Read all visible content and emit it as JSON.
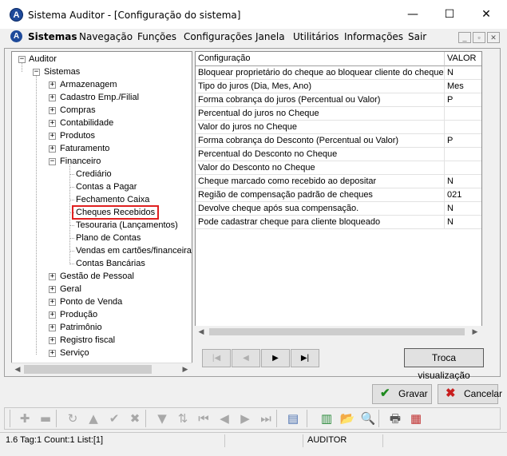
{
  "window": {
    "title": "Sistema Auditor - [Configuração do sistema]",
    "app_icon": "A",
    "minimize": "—",
    "maximize": "☐",
    "close": "✕"
  },
  "menu": {
    "icon": "A",
    "items": [
      "Sistemas",
      "Navegação",
      "Funções",
      "Configurações",
      "Janela",
      "Utilitários",
      "Informações",
      "Sair"
    ],
    "mdi_buttons": [
      "_",
      "▫",
      "✕"
    ]
  },
  "tree": {
    "root": "Auditor",
    "level1": "Sistemas",
    "items": [
      "Armazenagem",
      "Cadastro Emp./Filial",
      "Compras",
      "Contabilidade",
      "Produtos",
      "Faturamento",
      "Financeiro"
    ],
    "financeiro_children": [
      "Crediário",
      "Contas a Pagar",
      "Fechamento Caixa",
      "Cheques Recebidos",
      "Tesouraria (Lançamentos)",
      "Plano de Contas",
      "Vendas em cartões/financeiras",
      "Contas Bancárias"
    ],
    "items_after": [
      "Gestão de Pessoal",
      "Geral",
      "Ponto de Venda",
      "Produção",
      "Patrimônio",
      "Registro fiscal",
      "Serviço"
    ],
    "selected": "Cheques Recebidos"
  },
  "grid": {
    "columns": [
      "Configuração",
      "VALOR"
    ],
    "rows": [
      [
        "Bloquear proprietário do cheque ao bloquear cliente do cheque",
        "N"
      ],
      [
        "Tipo do juros (Dia, Mes, Ano)",
        "Mes"
      ],
      [
        "Forma cobrança do juros (Percentual ou Valor)",
        "P"
      ],
      [
        "Percentual do juros no Cheque",
        ""
      ],
      [
        "Valor do juros no Cheque",
        ""
      ],
      [
        "Forma cobrança do Desconto (Percentual ou Valor)",
        "P"
      ],
      [
        "Percentual do Desconto no Cheque",
        ""
      ],
      [
        "Valor do Desconto no Cheque",
        ""
      ],
      [
        "Cheque marcado como recebido ao depositar",
        "N"
      ],
      [
        "Região de compensação padrão de cheques",
        "021"
      ],
      [
        "Devolve cheque após sua compensação.",
        "N"
      ],
      [
        "Pode cadastrar cheque para cliente bloqueado",
        "N"
      ]
    ]
  },
  "nav": {
    "first": "|◀",
    "prev": "◀",
    "next": "▶",
    "last": "▶|",
    "toggle_view": "Troca visualização"
  },
  "actions": {
    "save_label": "Gravar",
    "save_icon": "✔",
    "cancel_label": "Cancelar",
    "cancel_icon": "✖"
  },
  "toolbar": {
    "icons": [
      "plus-icon",
      "minus-icon",
      "refresh-icon",
      "triangle-up-icon",
      "check-icon",
      "x-icon",
      "filter-icon",
      "sort-icon",
      "first-icon",
      "left-icon",
      "right-icon",
      "last-icon",
      "copy-icon",
      "export-icon",
      "folder-icon",
      "search-icon",
      "print-icon",
      "calendar-icon"
    ],
    "glyphs": [
      "✚",
      "▬",
      "↻",
      "▲",
      "✔",
      "✖",
      "▼",
      "⇅",
      "⏮",
      "◀",
      "▶",
      "⏭",
      "▤",
      "▥",
      "📂",
      "🔍",
      "🖶",
      "▦"
    ]
  },
  "status": {
    "left": "1.6 Tag:1 Count:1 List:[1]",
    "middle": "",
    "user": "AUDITOR",
    "right": ""
  },
  "colors": {
    "selection_border": "#e02020",
    "save_icon": "#1e8a1e",
    "cancel_icon": "#c81e1e"
  }
}
